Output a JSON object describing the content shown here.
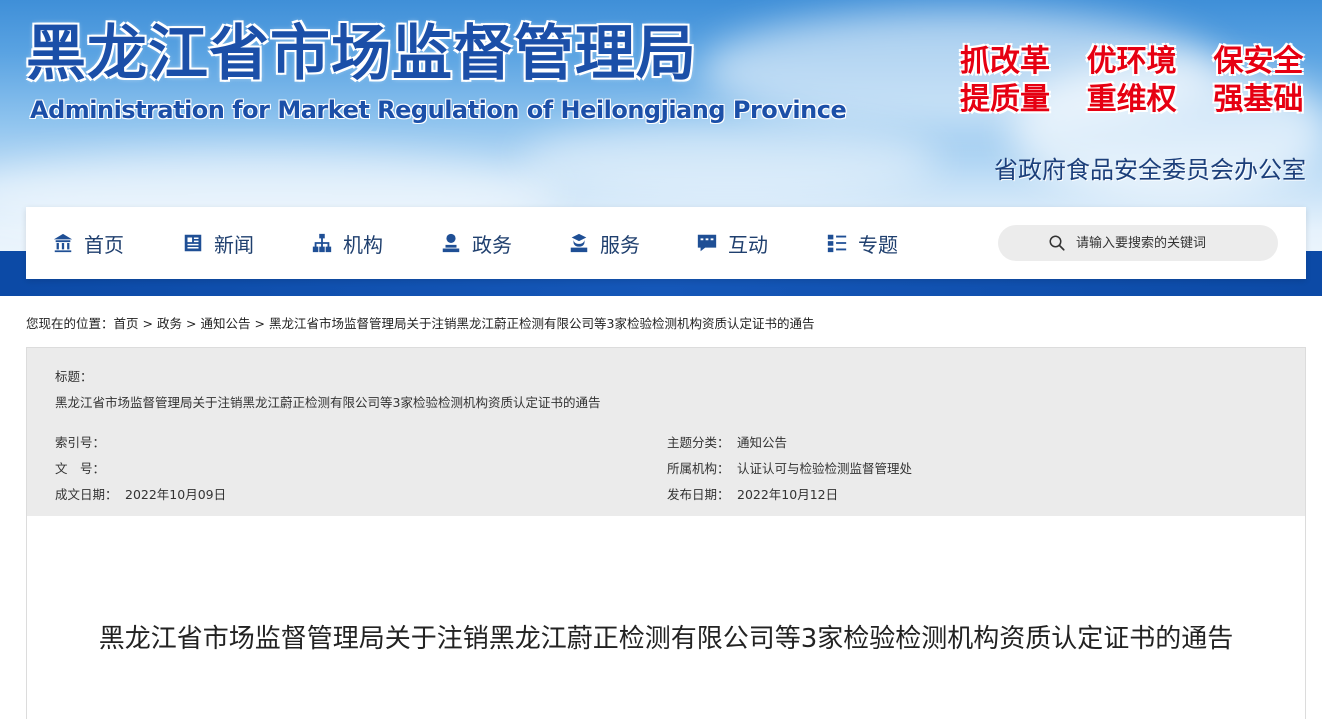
{
  "header": {
    "title": "黑龙江省市场监督管理局",
    "subtitle": "Administration for Market Regulation of Heilongjiang Province",
    "slogans": [
      "抓改革",
      "优环境",
      "保安全",
      "提质量",
      "重维权",
      "强基础"
    ],
    "office": "省政府食品安全委员会办公室",
    "brand_color": "#1b4fa8",
    "slogan_color": "#e60012"
  },
  "nav": {
    "items": [
      {
        "label": "首页",
        "icon": "home-icon"
      },
      {
        "label": "新闻",
        "icon": "news-icon"
      },
      {
        "label": "机构",
        "icon": "org-icon"
      },
      {
        "label": "政务",
        "icon": "gov-icon"
      },
      {
        "label": "服务",
        "icon": "service-icon"
      },
      {
        "label": "互动",
        "icon": "chat-icon"
      },
      {
        "label": "专题",
        "icon": "topic-icon"
      }
    ],
    "search_placeholder": "请输入要搜索的关键词"
  },
  "breadcrumb": {
    "prefix": "您现在的位置：",
    "items": [
      "首页",
      "政务",
      "通知公告",
      "黑龙江省市场监督管理局关于注销黑龙江蔚正检测有限公司等3家检验检测机构资质认定证书的通告"
    ]
  },
  "info": {
    "title_label": "标题：",
    "title_value": "黑龙江省市场监督管理局关于注销黑龙江蔚正检测有限公司等3家检验检测机构资质认定证书的通告",
    "index_label": "索引号：",
    "index_value": "",
    "doc_label": "文　号：",
    "doc_value": "",
    "created_label": "成文日期：",
    "created_value": "2022年10月09日",
    "category_label": "主题分类：",
    "category_value": "通知公告",
    "dept_label": "所属机构：",
    "dept_value": "认证认可与检验检测监督管理处",
    "published_label": "发布日期：",
    "published_value": "2022年10月12日"
  },
  "article": {
    "title": "黑龙江省市场监督管理局关于注销黑龙江蔚正检测有限公司等3家检验检测机构资质认定证书的通告"
  }
}
